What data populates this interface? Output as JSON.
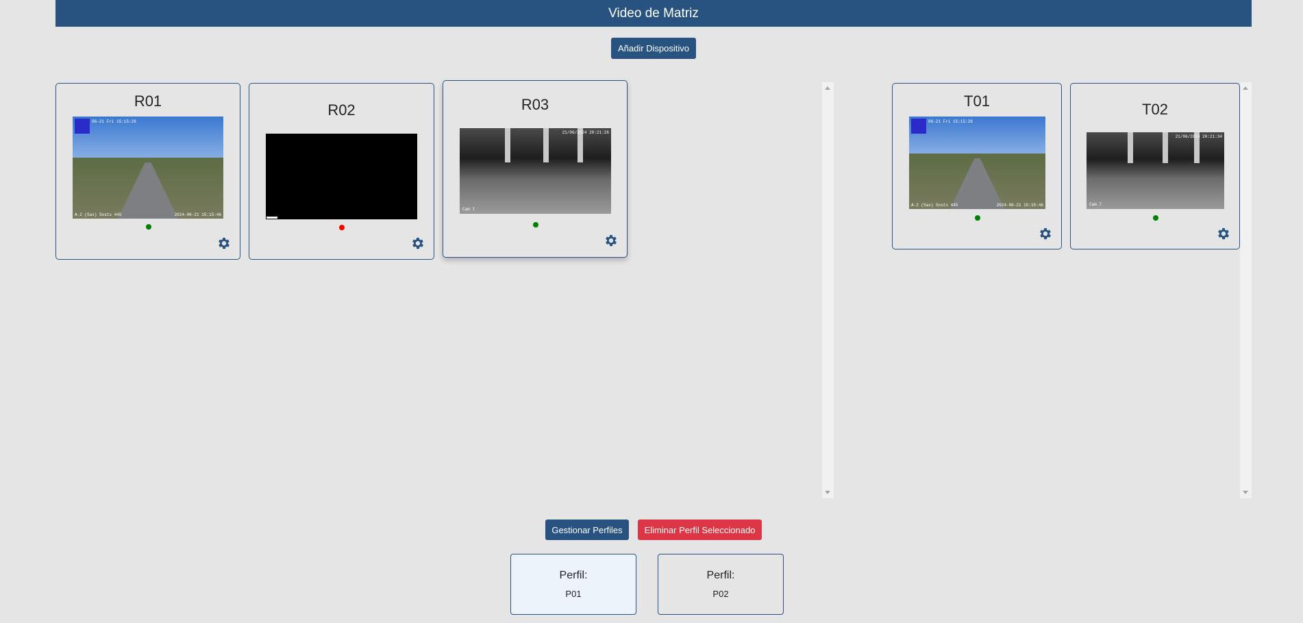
{
  "header": {
    "title": "Video de Matriz"
  },
  "toolbar": {
    "add_device_label": "Añadir Dispositivo"
  },
  "receivers": [
    {
      "name": "R01",
      "status": "online",
      "status_color": "#008000",
      "feed": "road",
      "overlay_top": "06-21 Fri 15:15:26",
      "overlay_bl": "A-2 (Sax) Sosts 445",
      "overlay_br": "2024-06-21 15:15:46"
    },
    {
      "name": "R02",
      "status": "offline",
      "status_color": "#ff0000",
      "feed": "black"
    },
    {
      "name": "R03",
      "status": "online",
      "status_color": "#008000",
      "feed": "garage",
      "overlay_top": "21/06/2024 20:21:26",
      "overlay_bl": "Cam 7"
    }
  ],
  "transmitters": [
    {
      "name": "T01",
      "status": "online",
      "status_color": "#008000",
      "feed": "road",
      "overlay_top": "06-21 Fri 15:15:26",
      "overlay_bl": "A-2 (Sax) Sosts 445",
      "overlay_br": "2024-06-21 15:15:46"
    },
    {
      "name": "T02",
      "status": "online",
      "status_color": "#008000",
      "feed": "garage",
      "overlay_top": "21/06/2024 20:21:34",
      "overlay_bl": "Cam 7"
    }
  ],
  "footer": {
    "manage_profiles_label": "Gestionar Perfiles",
    "delete_profile_label": "Eliminar Perfil Seleccionado"
  },
  "profiles": [
    {
      "label": "Perfil:",
      "name": "P01",
      "selected": true
    },
    {
      "label": "Perfil:",
      "name": "P02",
      "selected": false
    }
  ],
  "colors": {
    "primary": "#285380",
    "danger": "#dc3545",
    "online": "#008000",
    "offline": "#ff0000",
    "background": "#e5e5e5"
  },
  "icons": {
    "settings": "gear-icon"
  }
}
